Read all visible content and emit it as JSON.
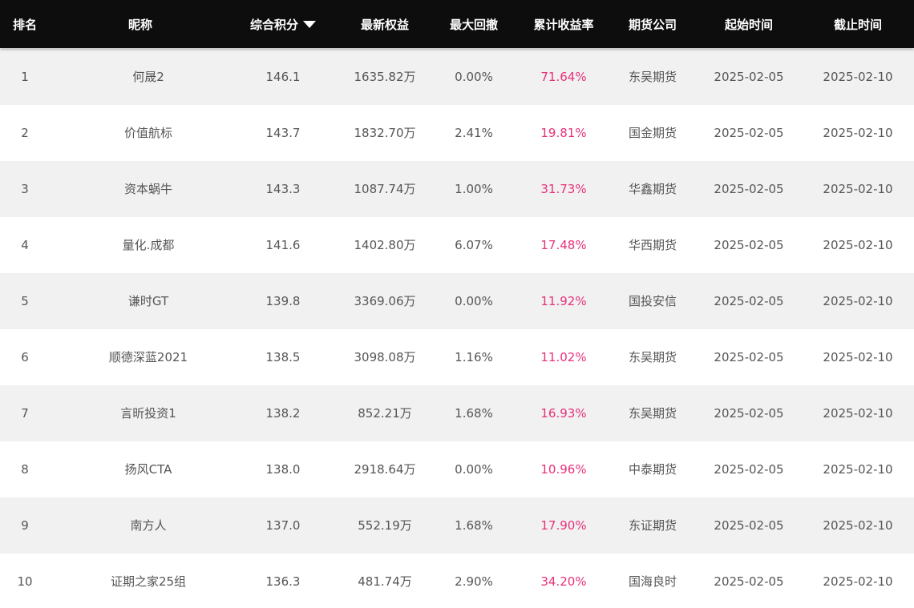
{
  "headers": {
    "rank": "排名",
    "nickname": "昵称",
    "score": "综合积分",
    "equity": "最新权益",
    "drawdown": "最大回撤",
    "return_rate": "累计收益率",
    "company": "期货公司",
    "start": "起始时间",
    "end": "截止时间"
  },
  "sort_icon": "caret-down-icon",
  "colors": {
    "header_bg": "#0d0d0d",
    "odd_row_bg": "#f1f1f1",
    "return_rate": "#e8307a"
  },
  "rows": [
    {
      "rank": "1",
      "nickname": "何晟2",
      "score": "146.1",
      "equity": "1635.82万",
      "drawdown": "0.00%",
      "return_rate": "71.64%",
      "company": "东吴期货",
      "start": "2025-02-05",
      "end": "2025-02-10"
    },
    {
      "rank": "2",
      "nickname": "价值航标",
      "score": "143.7",
      "equity": "1832.70万",
      "drawdown": "2.41%",
      "return_rate": "19.81%",
      "company": "国金期货",
      "start": "2025-02-05",
      "end": "2025-02-10"
    },
    {
      "rank": "3",
      "nickname": "资本蜗牛",
      "score": "143.3",
      "equity": "1087.74万",
      "drawdown": "1.00%",
      "return_rate": "31.73%",
      "company": "华鑫期货",
      "start": "2025-02-05",
      "end": "2025-02-10"
    },
    {
      "rank": "4",
      "nickname": "量化.成都",
      "score": "141.6",
      "equity": "1402.80万",
      "drawdown": "6.07%",
      "return_rate": "17.48%",
      "company": "华西期货",
      "start": "2025-02-05",
      "end": "2025-02-10"
    },
    {
      "rank": "5",
      "nickname": "谦时GT",
      "score": "139.8",
      "equity": "3369.06万",
      "drawdown": "0.00%",
      "return_rate": "11.92%",
      "company": "国投安信",
      "start": "2025-02-05",
      "end": "2025-02-10"
    },
    {
      "rank": "6",
      "nickname": "顺德深蓝2021",
      "score": "138.5",
      "equity": "3098.08万",
      "drawdown": "1.16%",
      "return_rate": "11.02%",
      "company": "东吴期货",
      "start": "2025-02-05",
      "end": "2025-02-10"
    },
    {
      "rank": "7",
      "nickname": "言昕投资1",
      "score": "138.2",
      "equity": "852.21万",
      "drawdown": "1.68%",
      "return_rate": "16.93%",
      "company": "东吴期货",
      "start": "2025-02-05",
      "end": "2025-02-10"
    },
    {
      "rank": "8",
      "nickname": "扬风CTA",
      "score": "138.0",
      "equity": "2918.64万",
      "drawdown": "0.00%",
      "return_rate": "10.96%",
      "company": "中泰期货",
      "start": "2025-02-05",
      "end": "2025-02-10"
    },
    {
      "rank": "9",
      "nickname": "南方人",
      "score": "137.0",
      "equity": "552.19万",
      "drawdown": "1.68%",
      "return_rate": "17.90%",
      "company": "东证期货",
      "start": "2025-02-05",
      "end": "2025-02-10"
    },
    {
      "rank": "10",
      "nickname": "证期之家25组",
      "score": "136.3",
      "equity": "481.74万",
      "drawdown": "2.90%",
      "return_rate": "34.20%",
      "company": "国海良时",
      "start": "2025-02-05",
      "end": "2025-02-10"
    }
  ]
}
